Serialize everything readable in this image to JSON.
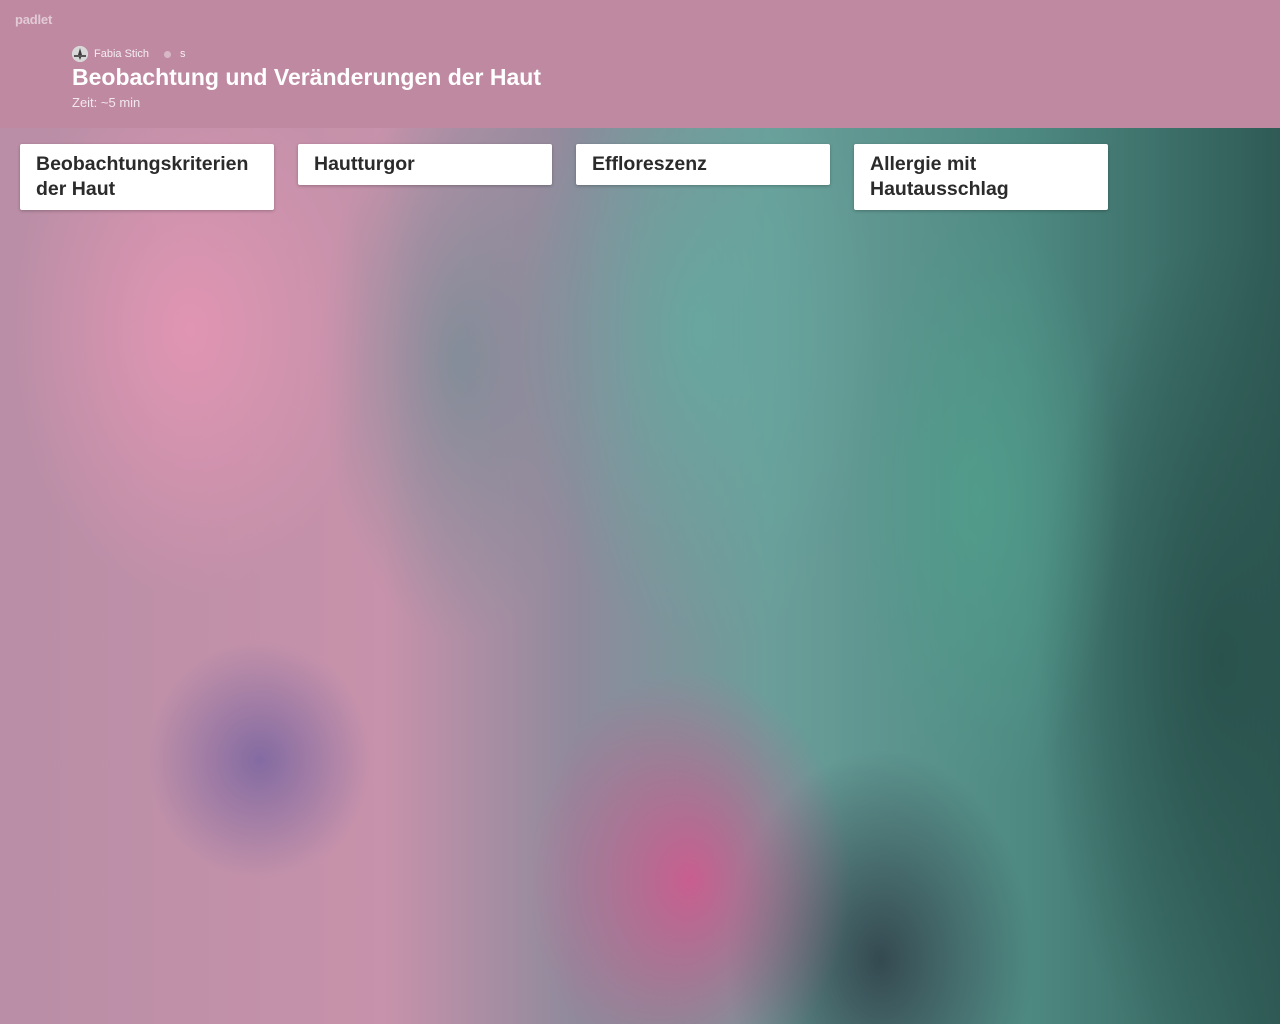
{
  "app": {
    "logo": "padlet"
  },
  "header": {
    "author": "Fabia Stich",
    "extra": "s",
    "title": "Beobachtung und Veränderungen der Haut",
    "subtitle": "Zeit: ~5 min",
    "background_color": "#bf89a2"
  },
  "columns": [
    {
      "title": "Beobachtungskriterien der Haut"
    },
    {
      "title": "Hautturgor"
    },
    {
      "title": "Effloreszenz"
    },
    {
      "title": "Allergie mit Hautausschlag"
    }
  ]
}
